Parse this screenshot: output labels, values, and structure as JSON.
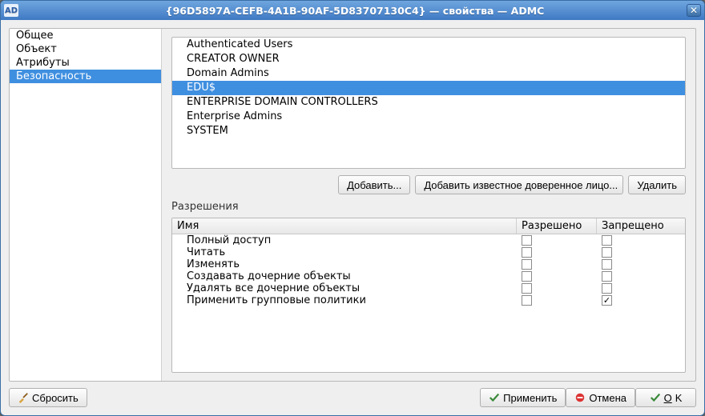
{
  "titlebar": {
    "badge": "AD",
    "title": "{96D5897A-CEFB-4A1B-90AF-5D83707130C4} — свойства — ADMC"
  },
  "nav": {
    "items": [
      {
        "label": "Общее",
        "selected": false
      },
      {
        "label": "Объект",
        "selected": false
      },
      {
        "label": "Атрибуты",
        "selected": false
      },
      {
        "label": "Безопасность",
        "selected": true
      }
    ]
  },
  "principals": [
    {
      "label": "Authenticated Users",
      "selected": false
    },
    {
      "label": "CREATOR OWNER",
      "selected": false
    },
    {
      "label": "Domain Admins",
      "selected": false
    },
    {
      "label": "EDU$",
      "selected": true
    },
    {
      "label": "ENTERPRISE DOMAIN CONTROLLERS",
      "selected": false
    },
    {
      "label": "Enterprise Admins",
      "selected": false
    },
    {
      "label": "SYSTEM",
      "selected": false
    }
  ],
  "buttons": {
    "add": "Добавить...",
    "add_known": "Добавить известное доверенное лицо...",
    "remove": "Удалить"
  },
  "permissions": {
    "section_label": "Разрешения",
    "headers": {
      "name": "Имя",
      "allow": "Разрешено",
      "deny": "Запрещено"
    },
    "rows": [
      {
        "name": "Полный доступ",
        "allow": false,
        "deny": false
      },
      {
        "name": "Читать",
        "allow": false,
        "deny": false
      },
      {
        "name": "Изменять",
        "allow": false,
        "deny": false
      },
      {
        "name": "Создавать дочерние объекты",
        "allow": false,
        "deny": false
      },
      {
        "name": "Удалять все дочерние объекты",
        "allow": false,
        "deny": false
      },
      {
        "name": "Применить групповые политики",
        "allow": false,
        "deny": true
      }
    ]
  },
  "footer": {
    "reset": "Сбросить",
    "apply": "Применить",
    "cancel": "Отмена",
    "ok": "OK"
  }
}
